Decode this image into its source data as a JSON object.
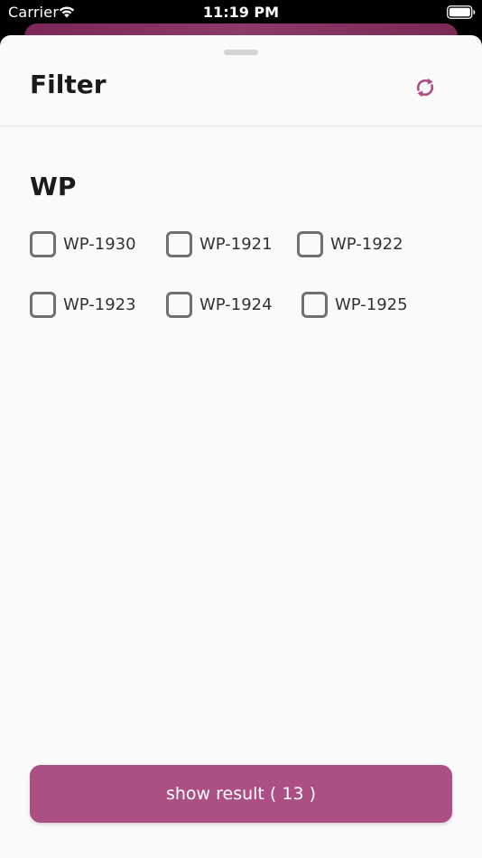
{
  "status_bar": {
    "carrier": "Carrier",
    "time": "11:19 PM",
    "wifi_icon": "wifi-icon",
    "battery_icon": "battery-icon"
  },
  "sheet": {
    "title": "Filter",
    "reset_icon": "refresh-icon",
    "accent_color": "#ac4f85"
  },
  "section": {
    "title": "WP",
    "options": [
      {
        "label": "WP-1930",
        "checked": false
      },
      {
        "label": "WP-1921",
        "checked": false
      },
      {
        "label": "WP-1922",
        "checked": false
      },
      {
        "label": "WP-1923",
        "checked": false
      },
      {
        "label": "WP-1924",
        "checked": false
      },
      {
        "label": "WP-1925",
        "checked": false
      }
    ]
  },
  "footer": {
    "show_result_label": "show result ( 13 )"
  }
}
